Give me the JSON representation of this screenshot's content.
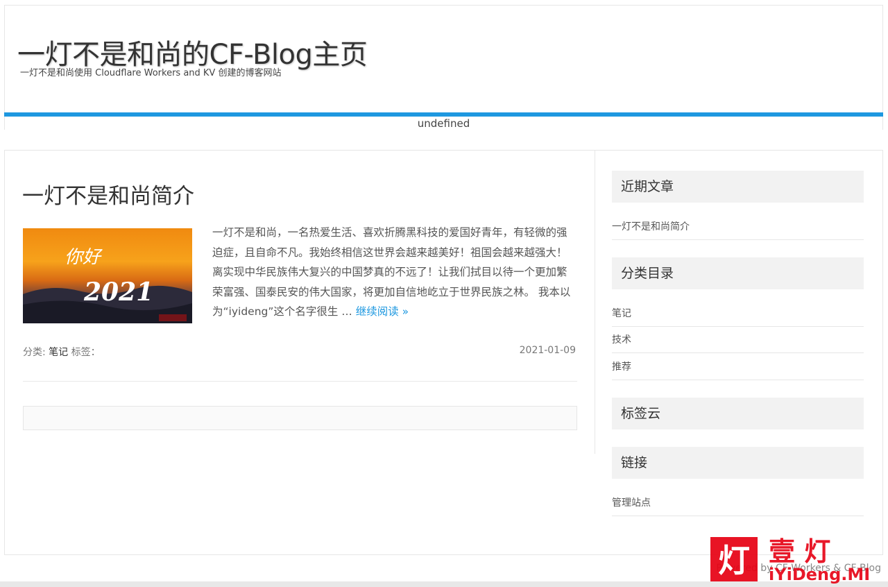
{
  "header": {
    "title": "一灯不是和尚的CF-Blog主页",
    "description": "一灯不是和尚使用 Cloudflare Workers and KV 创建的博客网站",
    "nav_text": "undefined"
  },
  "post": {
    "title": "一灯不是和尚简介",
    "thumbnail_text_1": "你好",
    "thumbnail_text_2": "2021",
    "excerpt": "一灯不是和尚，一名热爱生活、喜欢折腾黑科技的爱国好青年，有轻微的强迫症，且自命不凡。我始终相信这世界会越来越美好！祖国会越来越强大！离实现中华民族伟大复兴的中国梦真的不远了！让我们拭目以待一个更加繁荣富强、国泰民安的伟大国家，将更加自信地屹立于世界民族之林。 我本以为“iyideng”这个名字很生 … ",
    "read_more": "继续阅读 »",
    "category_label": "分类: ",
    "category": "笔记",
    "tags_label": " 标签：",
    "date": "2021-01-09"
  },
  "sidebar": {
    "recent_title": "近期文章",
    "recent_items": [
      "一灯不是和尚简介"
    ],
    "categories_title": "分类目录",
    "categories": [
      "笔记",
      "技术",
      "推荐"
    ],
    "tags_title": "标签云",
    "links_title": "链接",
    "links": [
      "管理站点"
    ]
  },
  "footer": {
    "text": "Powered by CF-Workers & CF-Blog"
  },
  "watermark": {
    "char_left": "灯",
    "char_right": "壹 灯",
    "domain": "iYiDeng.ME"
  },
  "colors": {
    "accent": "#1e98e0",
    "watermark_red": "#e60012"
  }
}
